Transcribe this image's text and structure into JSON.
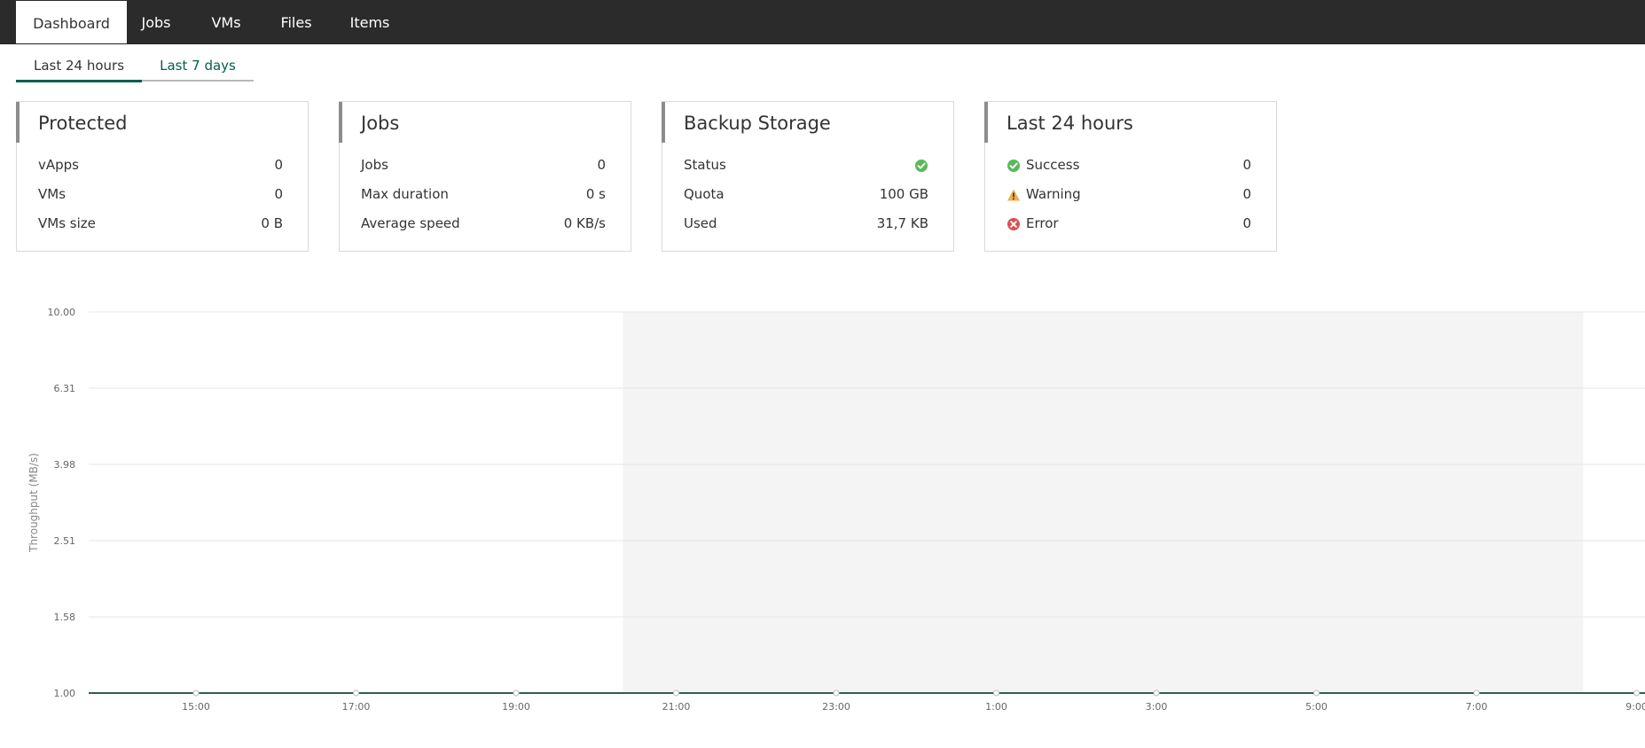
{
  "nav": {
    "tabs": [
      {
        "label": "Dashboard"
      },
      {
        "label": "Jobs"
      },
      {
        "label": "VMs"
      },
      {
        "label": "Files"
      },
      {
        "label": "Items"
      }
    ]
  },
  "period_tabs": [
    {
      "label": "Last 24 hours"
    },
    {
      "label": "Last 7 days"
    }
  ],
  "cards": {
    "protected": {
      "title": "Protected",
      "rows": [
        {
          "label": "vApps",
          "value": "0"
        },
        {
          "label": "VMs",
          "value": "0"
        },
        {
          "label": "VMs size",
          "value": "0 B"
        }
      ]
    },
    "jobs": {
      "title": "Jobs",
      "rows": [
        {
          "label": "Jobs",
          "value": "0"
        },
        {
          "label": "Max duration",
          "value": "0 s"
        },
        {
          "label": "Average speed",
          "value": "0 KB/s"
        }
      ]
    },
    "storage": {
      "title": "Backup Storage",
      "rows": [
        {
          "label": "Status",
          "value": "",
          "icon": "check-circle-icon"
        },
        {
          "label": "Quota",
          "value": "100 GB"
        },
        {
          "label": "Used",
          "value": "31,7 KB"
        }
      ]
    },
    "last24": {
      "title": "Last 24 hours",
      "rows": [
        {
          "label": "Success",
          "value": "0",
          "icon": "check-circle-icon"
        },
        {
          "label": "Warning",
          "value": "0",
          "icon": "warning-icon"
        },
        {
          "label": "Error",
          "value": "0",
          "icon": "error-icon"
        }
      ]
    }
  },
  "colors": {
    "accent": "#005f4b",
    "success": "#5cb85c",
    "warning": "#f0ad4e",
    "error": "#d9534f",
    "nav_bg": "#2b2b2b"
  },
  "chart_data": {
    "type": "line",
    "ylabel": "Throughput (MB/s)",
    "y_ticks": [
      "10.00",
      "6.31",
      "3.98",
      "2.51",
      "1.58",
      "1.00"
    ],
    "ylim": [
      1,
      10
    ],
    "scale": "log",
    "x_ticks": [
      "15:00",
      "17:00",
      "19:00",
      "21:00",
      "23:00",
      "1:00",
      "3:00",
      "5:00",
      "7:00",
      "9:00"
    ],
    "shaded_band": {
      "from": "20:20",
      "to": "8:20"
    },
    "series": [
      {
        "values": [
          1,
          1,
          1,
          1,
          1,
          1,
          1,
          1,
          1,
          1
        ]
      }
    ],
    "grid": true
  }
}
